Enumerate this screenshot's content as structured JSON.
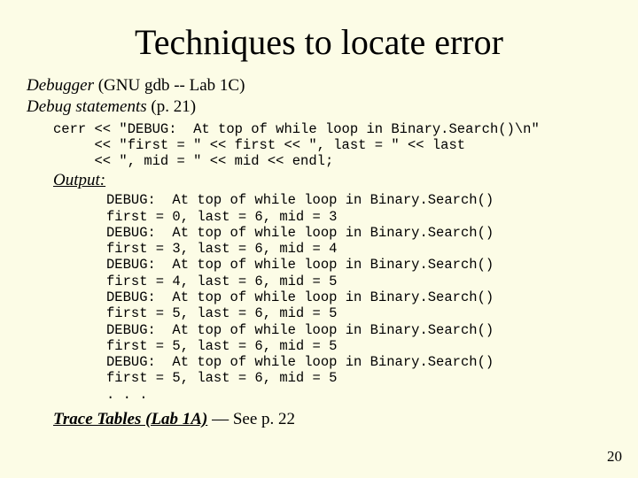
{
  "title": "Techniques to locate error",
  "debugger_label": "Debugger",
  "debugger_note": "    (GNU gdb -- Lab 1C)",
  "debug_stmts_label": "Debug statements",
  "debug_stmts_note": " (p. 21)",
  "code": "cerr << \"DEBUG:  At top of while loop in Binary.Search()\\n\"\n     << \"first = \" << first << \", last = \" << last\n     << \", mid = \" << mid << endl;",
  "output_label": "Output:",
  "output": "DEBUG:  At top of while loop in Binary.Search()\nfirst = 0, last = 6, mid = 3\nDEBUG:  At top of while loop in Binary.Search()\nfirst = 3, last = 6, mid = 4\nDEBUG:  At top of while loop in Binary.Search()\nfirst = 4, last = 6, mid = 5\nDEBUG:  At top of while loop in Binary.Search()\nfirst = 5, last = 6, mid = 5\nDEBUG:  At top of while loop in Binary.Search()\nfirst = 5, last = 6, mid = 5\nDEBUG:  At top of while loop in Binary.Search()\nfirst = 5, last = 6, mid = 5\n. . .",
  "footer_strong": "Trace Tables (Lab 1A)",
  "footer_rest": " — See p. 22",
  "page_number": "20"
}
